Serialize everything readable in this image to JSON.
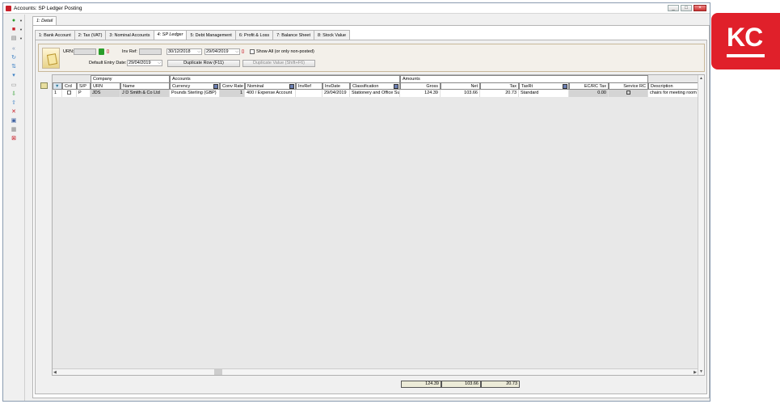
{
  "window": {
    "title": "Accounts: SP Ledger Posting",
    "min": "_",
    "max": "□",
    "close": "×"
  },
  "outer_tab": "1: Detail",
  "tabs": [
    "1: Bank Account",
    "2: Tax (VAT)",
    "3: Nominal Accounts",
    "4: SP Ledger",
    "5: Debt Management",
    "6: Profit & Loss",
    "7: Balance Sheet",
    "8: Stock Value"
  ],
  "filter": {
    "urn_label": "URN:",
    "urn_value": "",
    "inv_ref_label": "Inv Ref:",
    "inv_ref_value": "",
    "date_from": "30/12/2018",
    "date_to": "29/04/2019",
    "show_all_label": "Show All (or only non-posted)",
    "default_entry_label": "Default Entry Date:",
    "default_entry_value": "29/04/2019",
    "duplicate_row": "Duplicate Row (F11)",
    "duplicate_value": "Duplicate Value (Shift+F6)"
  },
  "grid": {
    "groups": [
      "Company",
      "Accounts",
      "Amounts"
    ],
    "headers": [
      "Crd",
      "S/P",
      "URN",
      "Name",
      "Currency",
      "Conv Rate",
      "Nominal",
      "InvRef",
      "InvDate",
      "Classification",
      "Gross",
      "Net",
      "Tax",
      "TaxRt",
      "EC/RC Tax",
      "Service RC",
      "Description"
    ],
    "rows": [
      {
        "row_num": "1",
        "sp": "P",
        "urn": "JDS",
        "name": "J D Smith & Co Ltd",
        "currency": "Pounds Sterling (GBP)",
        "conv_rate": "1",
        "nominal": "400 / Expense Account",
        "invref": "",
        "invdate": "29/04/2019",
        "classification": "Stationery and Office Su",
        "gross": "124.39",
        "net": "103.66",
        "tax": "20.73",
        "taxrt": "Standard",
        "ecrc_tax": "0.00",
        "service_rc": "",
        "description": "chairs for meeting room"
      }
    ],
    "totals": {
      "gross": "124.39",
      "net": "103.66",
      "tax": "20.73"
    }
  },
  "brand": {
    "logo_text": "KC",
    "color": "#e0202a"
  }
}
